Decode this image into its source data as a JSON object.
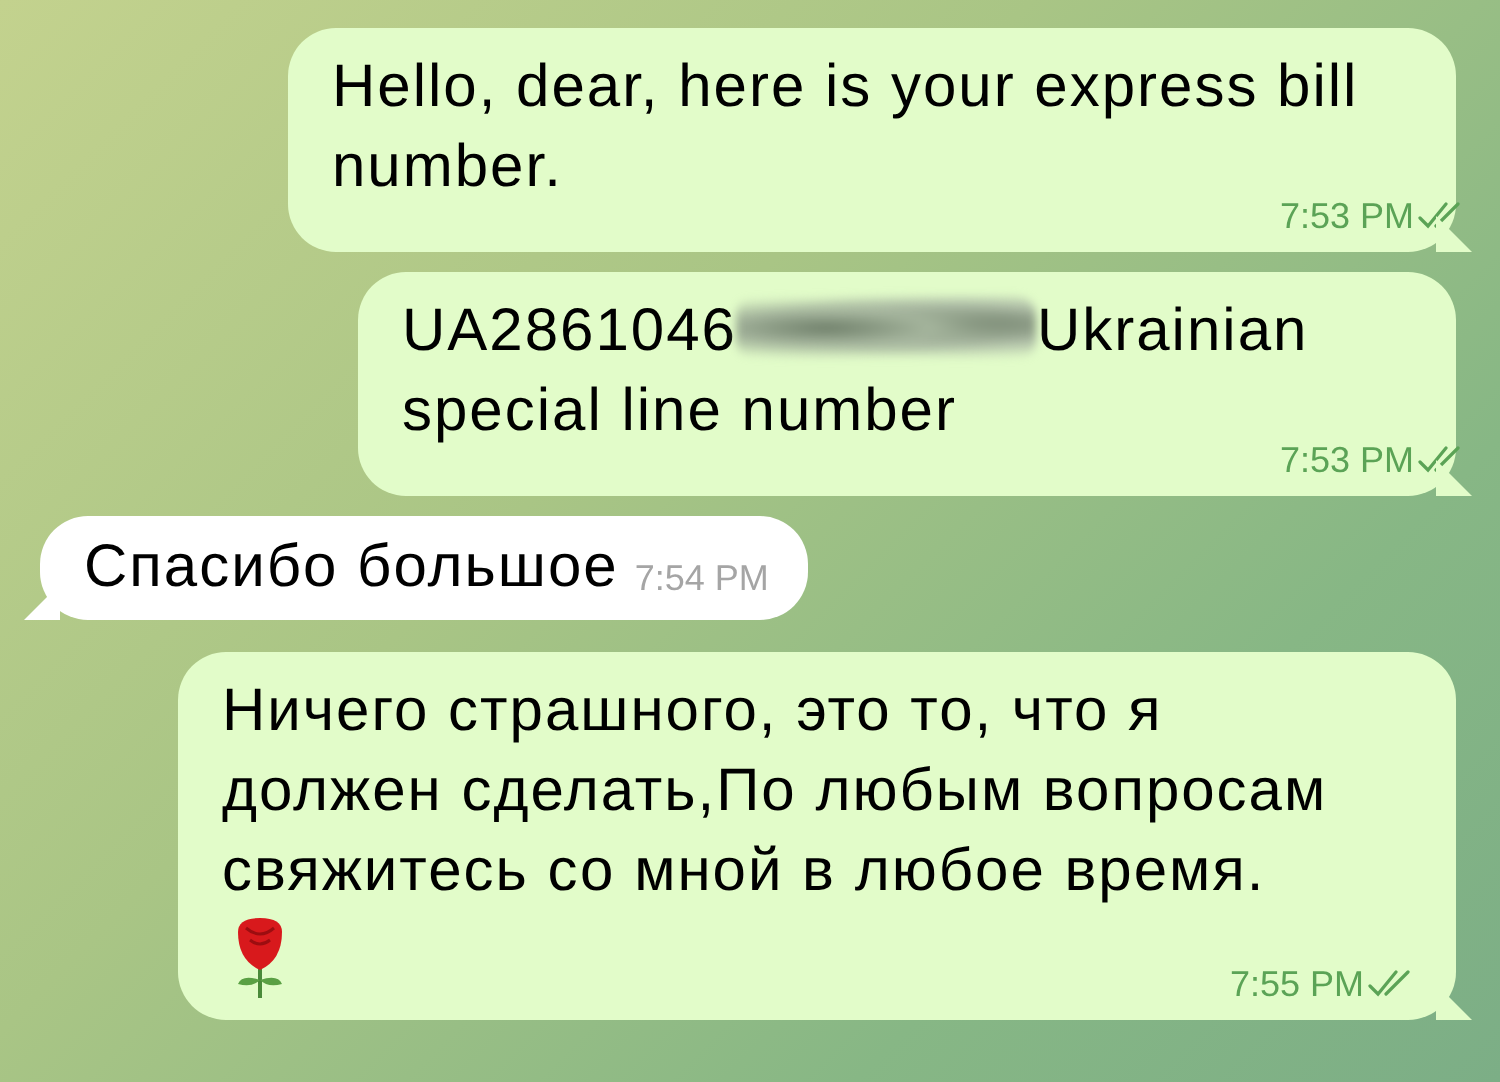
{
  "messages": [
    {
      "kind": "outgoing",
      "text": "Hello, dear, here is your express bill number.",
      "time": "7:53 PM",
      "read": true
    },
    {
      "kind": "outgoing",
      "text": "UA2861046",
      "redacted": true,
      "text_after": "Ukrainian",
      "text_line2": "special line number",
      "time": "7:53 PM",
      "read": true
    },
    {
      "kind": "incoming",
      "text": "Спасибо большое",
      "time": "7:54 PM"
    },
    {
      "kind": "outgoing",
      "text": "Ничего страшного, это то, что я должен сделать,По любым вопросам свяжитесь со мной в любое время.",
      "rose": true,
      "time": "7:55 PM",
      "read": true
    }
  ]
}
